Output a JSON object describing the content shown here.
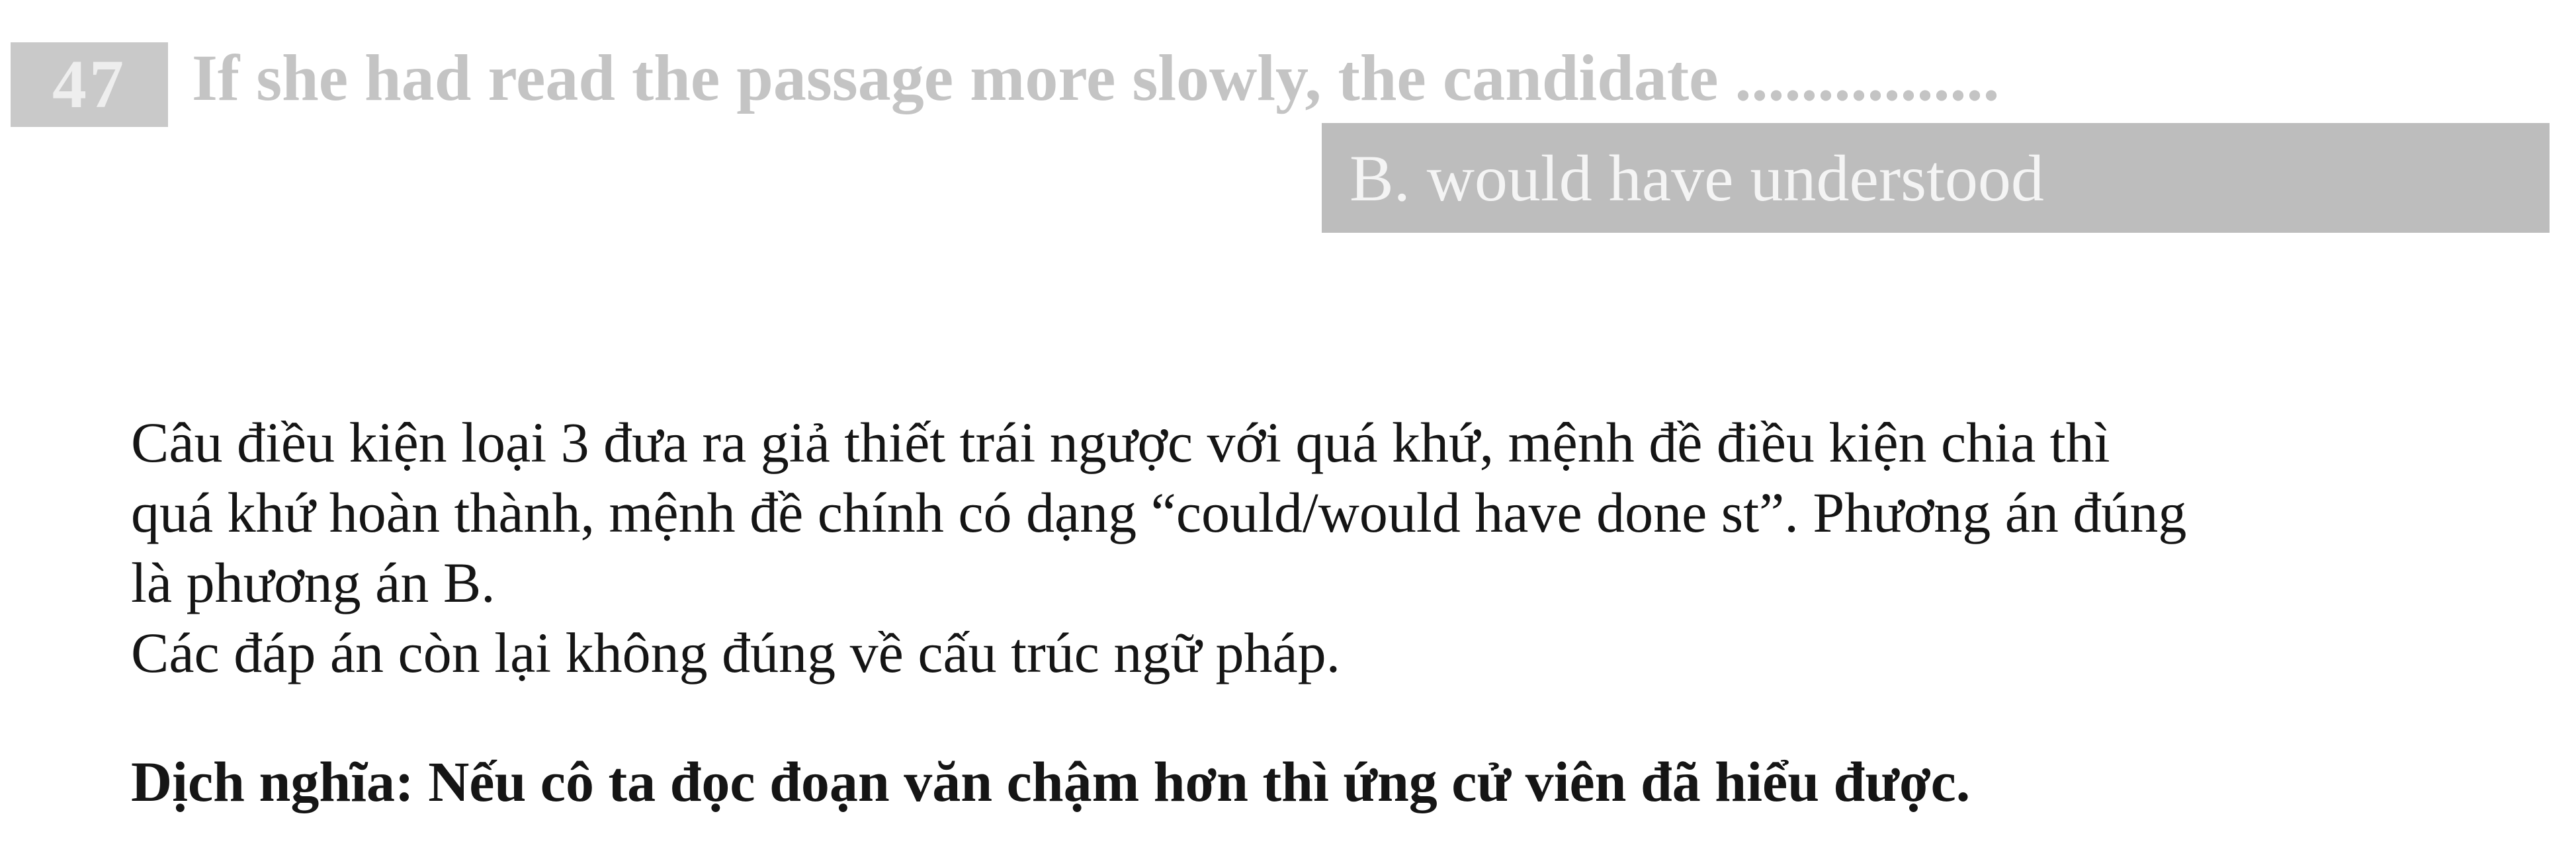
{
  "question": {
    "number": "47",
    "text": "If she had read the passage more slowly, the candidate ................"
  },
  "answer": {
    "label": "B. would have understood"
  },
  "explanation": {
    "line1": "Câu điều kiện loại 3 đưa ra giả thiết trái ngược với quá khứ,  mệnh đề điều kiện chia thì",
    "line2": "quá khứ hoàn thành, mệnh đề chính có dạng “could/would have done st”. Phương án đúng",
    "line3": "là phương án B.",
    "line4": "Các đáp án còn lại không đúng về cấu trúc ngữ pháp."
  },
  "translation": {
    "text": "Dịch nghĩa: Nếu cô ta đọc đoạn văn chậm hơn thì ứng cử viên đã hiểu được."
  },
  "colors": {
    "question_number_bg": "#c9c9c9",
    "question_text": "#c4c4c4",
    "answer_strip_bg": "#bdbdbd",
    "body_text": "#151515"
  }
}
